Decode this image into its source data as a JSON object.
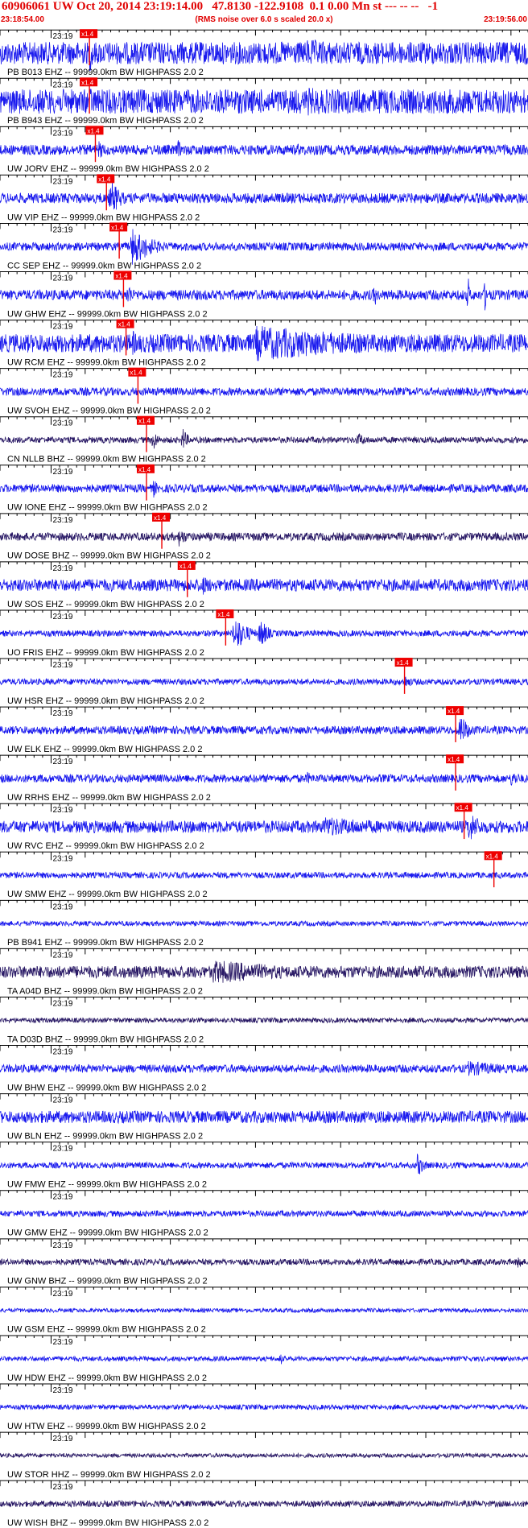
{
  "header": {
    "title": "60906061 UW Oct 20, 2014 23:19:14.00   47.8130 -122.9108  0.1 0.00 Mn st --- -- --   -1",
    "subtitle": "(RMS noise over 6.0 s scaled 20.0 x)",
    "start_time": "23:18:54.00",
    "end_time": "23:19:56.00"
  },
  "colors": {
    "trace": "#1a1aee",
    "trace_dark": "#2a1a66",
    "pick": "#ee0000",
    "text": "#000000",
    "header_text": "#e00000",
    "tick": "#000000"
  },
  "chart_data": {
    "type": "line",
    "title": "60906061 UW Oct 20, 2014 23:19:14.00   47.8130 -122.9108  0.1 0.00 Mn st --- -- --   -1",
    "x_range_seconds": [
      0,
      62
    ],
    "minute_label": "23:19",
    "minute_mark_second": 6,
    "traces": [
      {
        "label": "PB B013 EHZ -- 99999.0km BW  HIGHPASS  2.0  2",
        "pick_second": 10.5,
        "pick_label": "x1.4",
        "amplitude": 0.55,
        "color": "trace",
        "bursts": [
          {
            "t": 10.5,
            "dur": 1.5,
            "amp": 1.0
          },
          {
            "t": 36,
            "dur": 20,
            "amp": 0.7
          }
        ],
        "spikes": []
      },
      {
        "label": "PB B943 EHZ -- 99999.0km BW  HIGHPASS  2.0  2",
        "pick_second": 10.5,
        "pick_label": "x1.4",
        "amplitude": 0.6,
        "color": "trace",
        "bursts": [
          {
            "t": 10.5,
            "dur": 2,
            "amp": 0.8
          },
          {
            "t": 36,
            "dur": 20,
            "amp": 0.7
          }
        ],
        "spikes": []
      },
      {
        "label": "UW JORV EHZ -- 99999.0km BW  HIGHPASS  2.0  2",
        "pick_second": 11.2,
        "pick_label": "x1.4",
        "amplitude": 0.25,
        "color": "trace",
        "bursts": [
          {
            "t": 11.5,
            "dur": 2,
            "amp": 0.5
          }
        ],
        "spikes": [
          {
            "t": 21,
            "amp": 0.6
          },
          {
            "t": 35,
            "amp": 0.4
          }
        ]
      },
      {
        "label": "UW VIP EHZ -- 99999.0km BW  HIGHPASS  2.0  2",
        "pick_second": 12.5,
        "pick_label": "x1.4",
        "amplitude": 0.25,
        "color": "trace",
        "bursts": [
          {
            "t": 13,
            "dur": 2,
            "amp": 1.0
          }
        ],
        "spikes": []
      },
      {
        "label": "CC SEP EHZ -- 99999.0km BW  HIGHPASS  2.0  2",
        "pick_second": 14.0,
        "pick_label": "x1.4",
        "amplitude": 0.2,
        "color": "trace",
        "bursts": [
          {
            "t": 15.5,
            "dur": 4,
            "amp": 1.0
          }
        ],
        "spikes": []
      },
      {
        "label": "UW GHW EHZ -- 99999.0km BW  HIGHPASS  2.0  2",
        "pick_second": 14.5,
        "pick_label": "x1.4",
        "amplitude": 0.25,
        "color": "trace",
        "bursts": [
          {
            "t": 15,
            "dur": 1,
            "amp": 0.7
          }
        ],
        "spikes": [
          {
            "t": 44,
            "amp": 0.7
          },
          {
            "t": 55,
            "amp": 0.9
          },
          {
            "t": 57,
            "amp": 0.9
          }
        ]
      },
      {
        "label": "UW RCM EHZ -- 99999.0km BW  HIGHPASS  2.0  2",
        "pick_second": 14.8,
        "pick_label": "x1.4",
        "amplitude": 0.45,
        "color": "trace",
        "bursts": [
          {
            "t": 15.5,
            "dur": 2,
            "amp": 0.7
          },
          {
            "t": 30,
            "dur": 30,
            "amp": 0.9
          }
        ],
        "spikes": []
      },
      {
        "label": "UW SVOH EHZ -- 99999.0km BW  HIGHPASS  2.0  2",
        "pick_second": 16.2,
        "pick_label": "x1.4",
        "amplitude": 0.2,
        "color": "trace",
        "bursts": [],
        "spikes": []
      },
      {
        "label": "CN NLLB BHZ -- 99999.0km BW  HIGHPASS  2.0  2",
        "pick_second": 17.2,
        "pick_label": "x1.4",
        "amplitude": 0.15,
        "color": "trace_dark",
        "bursts": [
          {
            "t": 18,
            "dur": 1,
            "amp": 0.6
          },
          {
            "t": 21.5,
            "dur": 1,
            "amp": 0.6
          },
          {
            "t": 42,
            "dur": 2,
            "amp": 0.4
          }
        ],
        "spikes": []
      },
      {
        "label": "UW IONE EHZ -- 99999.0km BW  HIGHPASS  2.0  2",
        "pick_second": 17.2,
        "pick_label": "x1.4",
        "amplitude": 0.2,
        "color": "trace",
        "bursts": [
          {
            "t": 18,
            "dur": 1,
            "amp": 0.5
          }
        ],
        "spikes": []
      },
      {
        "label": "UW DOSE BHZ -- 99999.0km BW  HIGHPASS  2.0  2",
        "pick_second": 19.0,
        "pick_label": "x1.4",
        "amplitude": 0.2,
        "color": "trace_dark",
        "bursts": [
          {
            "t": 21,
            "dur": 2,
            "amp": 0.5
          }
        ],
        "spikes": []
      },
      {
        "label": "UW SOS EHZ -- 99999.0km BW  HIGHPASS  2.0  2",
        "pick_second": 22.0,
        "pick_label": "x1.4",
        "amplitude": 0.3,
        "color": "trace",
        "bursts": [
          {
            "t": 23.5,
            "dur": 3,
            "amp": 0.6
          }
        ],
        "spikes": []
      },
      {
        "label": "UO FRIS EHZ -- 99999.0km BW  HIGHPASS  2.0  2",
        "pick_second": 26.5,
        "pick_label": "x1.4",
        "amplitude": 0.15,
        "color": "trace",
        "bursts": [
          {
            "t": 27.5,
            "dur": 2.5,
            "amp": 1.0
          },
          {
            "t": 30.5,
            "dur": 1.5,
            "amp": 0.9
          }
        ],
        "spikes": []
      },
      {
        "label": "UW HSR EHZ -- 99999.0km BW  HIGHPASS  2.0  2",
        "pick_second": 47.5,
        "pick_label": "x1.4",
        "amplitude": 0.15,
        "color": "trace",
        "bursts": [
          {
            "t": 47.5,
            "dur": 2,
            "amp": 0.35
          }
        ],
        "spikes": []
      },
      {
        "label": "UW ELK EHZ -- 99999.0km BW  HIGHPASS  2.0  2",
        "pick_second": 53.5,
        "pick_label": "x1.4",
        "amplitude": 0.2,
        "color": "trace",
        "bursts": [
          {
            "t": 54,
            "dur": 2,
            "amp": 0.8
          }
        ],
        "spikes": []
      },
      {
        "label": "UW RRHS EHZ -- 99999.0km BW  HIGHPASS  2.0  2",
        "pick_second": 53.5,
        "pick_label": "x1.4",
        "amplitude": 0.2,
        "color": "trace",
        "bursts": [
          {
            "t": 36,
            "dur": 2,
            "amp": 0.35
          },
          {
            "t": 60,
            "dur": 3,
            "amp": 0.4
          }
        ],
        "spikes": []
      },
      {
        "label": "UW RVC EHZ -- 99999.0km BW  HIGHPASS  2.0  2",
        "pick_second": 54.5,
        "pick_label": "x1.4",
        "amplitude": 0.3,
        "color": "trace",
        "bursts": [
          {
            "t": 38,
            "dur": 20,
            "amp": 0.5
          },
          {
            "t": 55,
            "dur": 3,
            "amp": 0.8
          }
        ],
        "spikes": []
      },
      {
        "label": "UW SMW EHZ -- 99999.0km BW  HIGHPASS  2.0  2",
        "pick_second": 58.0,
        "pick_label": "x1.4",
        "amplitude": 0.15,
        "color": "trace",
        "bursts": [],
        "spikes": []
      },
      {
        "label": "PB B941 EHZ -- 99999.0km BW  HIGHPASS  2.0  2",
        "amplitude": 0.12,
        "color": "trace",
        "bursts": [],
        "spikes": []
      },
      {
        "label": "TA A04D BHZ -- 99999.0km BW  HIGHPASS  2.0  2",
        "amplitude": 0.3,
        "color": "trace_dark",
        "bursts": [
          {
            "t": 25,
            "dur": 20,
            "amp": 0.6
          }
        ],
        "spikes": []
      },
      {
        "label": "TA D03D BHZ -- 99999.0km BW  HIGHPASS  2.0  2",
        "amplitude": 0.12,
        "color": "trace_dark",
        "bursts": [],
        "spikes": []
      },
      {
        "label": "UW BHW EHZ -- 99999.0km BW  HIGHPASS  2.0  2",
        "amplitude": 0.2,
        "color": "trace",
        "bursts": [
          {
            "t": 55,
            "dur": 10,
            "amp": 0.4
          }
        ],
        "spikes": []
      },
      {
        "label": "UW BLN EHZ -- 99999.0km BW  HIGHPASS  2.0  2",
        "amplitude": 0.3,
        "color": "trace",
        "bursts": [],
        "spikes": []
      },
      {
        "label": "UW FMW EHZ -- 99999.0km BW  HIGHPASS  2.0  2",
        "amplitude": 0.15,
        "color": "trace",
        "bursts": [
          {
            "t": 49,
            "dur": 1.5,
            "amp": 0.6
          }
        ],
        "spikes": []
      },
      {
        "label": "UW GMW EHZ -- 99999.0km BW  HIGHPASS  2.0  2",
        "amplitude": 0.15,
        "color": "trace",
        "bursts": [],
        "spikes": []
      },
      {
        "label": "UW GNW BHZ -- 99999.0km BW  HIGHPASS  2.0  2",
        "amplitude": 0.15,
        "color": "trace_dark",
        "bursts": [],
        "spikes": [
          {
            "t": 61,
            "amp": 0.7
          }
        ]
      },
      {
        "label": "UW GSM EHZ -- 99999.0km BW  HIGHPASS  2.0  2",
        "amplitude": 0.1,
        "color": "trace",
        "bursts": [],
        "spikes": []
      },
      {
        "label": "UW HDW EHZ -- 99999.0km BW  HIGHPASS  2.0  2",
        "amplitude": 0.12,
        "color": "trace",
        "bursts": [],
        "spikes": [
          {
            "t": 33,
            "amp": 0.35
          }
        ]
      },
      {
        "label": "UW HTW EHZ -- 99999.0km BW  HIGHPASS  2.0  2",
        "amplitude": 0.12,
        "color": "trace",
        "bursts": [],
        "spikes": []
      },
      {
        "label": "UW STOR HHZ -- 99999.0km BW  HIGHPASS  2.0  2",
        "amplitude": 0.1,
        "color": "trace_dark",
        "bursts": [],
        "spikes": []
      },
      {
        "label": "UW WISH BHZ -- 99999.0km BW  HIGHPASS  2.0  2",
        "amplitude": 0.15,
        "color": "trace_dark",
        "bursts": [],
        "spikes": []
      }
    ]
  }
}
